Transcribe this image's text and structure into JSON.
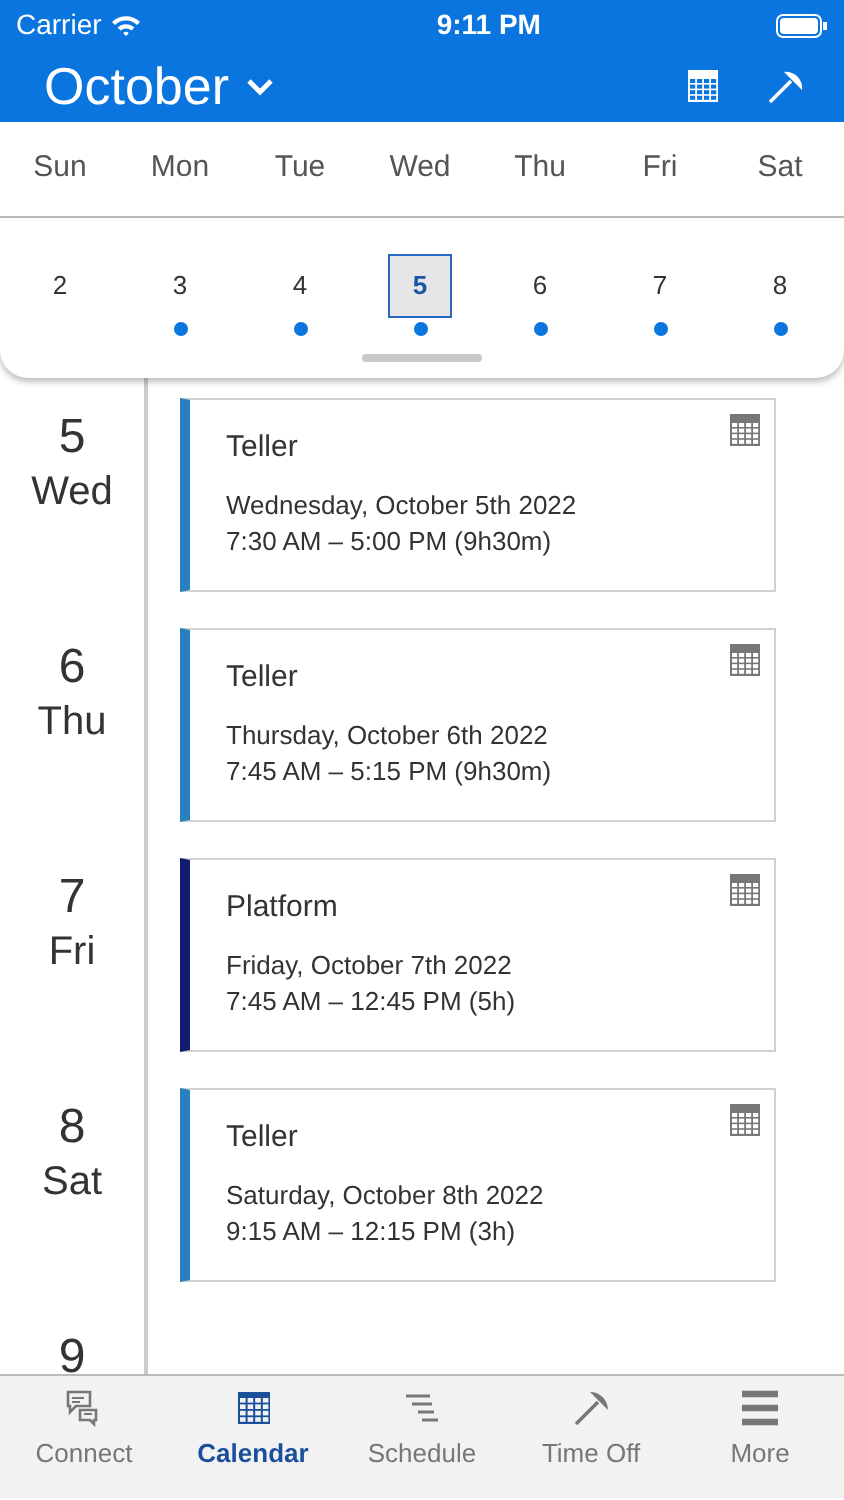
{
  "status_bar": {
    "carrier": "Carrier",
    "time": "9:11 PM"
  },
  "header": {
    "month": "October"
  },
  "weekdays": [
    "Sun",
    "Mon",
    "Tue",
    "Wed",
    "Thu",
    "Fri",
    "Sat"
  ],
  "dates": [
    {
      "day": "2",
      "has_shift": false,
      "selected": false
    },
    {
      "day": "3",
      "has_shift": true,
      "selected": false
    },
    {
      "day": "4",
      "has_shift": true,
      "selected": false
    },
    {
      "day": "5",
      "has_shift": true,
      "selected": true
    },
    {
      "day": "6",
      "has_shift": true,
      "selected": false
    },
    {
      "day": "7",
      "has_shift": true,
      "selected": false
    },
    {
      "day": "8",
      "has_shift": true,
      "selected": false
    }
  ],
  "days": [
    {
      "number": "5",
      "weekday": "Wed",
      "shift": {
        "role": "Teller",
        "date": "Wednesday, October 5th 2022",
        "hours": "7:30 AM – 5:00 PM (9h30m)",
        "color": "#2a7fbf"
      }
    },
    {
      "number": "6",
      "weekday": "Thu",
      "shift": {
        "role": "Teller",
        "date": "Thursday, October 6th 2022",
        "hours": "7:45 AM – 5:15 PM (9h30m)",
        "color": "#2a7fbf"
      }
    },
    {
      "number": "7",
      "weekday": "Fri",
      "shift": {
        "role": "Platform",
        "date": "Friday, October 7th 2022",
        "hours": "7:45 AM – 12:45 PM (5h)",
        "color": "#101c6e"
      }
    },
    {
      "number": "8",
      "weekday": "Sat",
      "shift": {
        "role": "Teller",
        "date": "Saturday, October 8th 2022",
        "hours": "9:15 AM – 12:15 PM (3h)",
        "color": "#2a7fbf"
      }
    },
    {
      "number": "9"
    }
  ],
  "tabs": [
    {
      "label": "Connect",
      "selected": false
    },
    {
      "label": "Calendar",
      "selected": true
    },
    {
      "label": "Schedule",
      "selected": false
    },
    {
      "label": "Time Off",
      "selected": false
    },
    {
      "label": "More",
      "selected": false
    }
  ]
}
